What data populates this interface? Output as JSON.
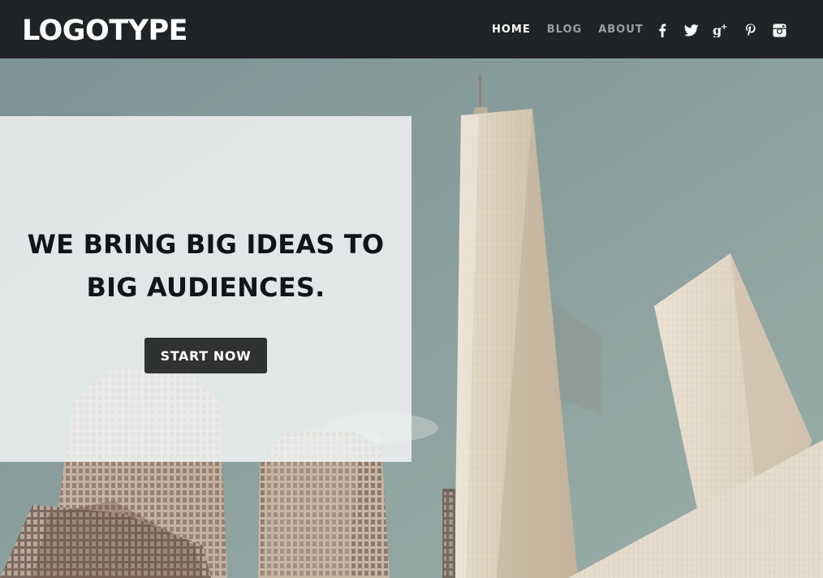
{
  "header": {
    "logo": "LOGOTYPE",
    "nav": [
      {
        "label": "HOME",
        "active": true
      },
      {
        "label": "BLOG",
        "active": false
      },
      {
        "label": "ABOUT",
        "active": false
      }
    ],
    "social": [
      "facebook-icon",
      "twitter-icon",
      "google-plus-icon",
      "pinterest-icon",
      "instagram-icon"
    ]
  },
  "hero": {
    "headline": "WE BRING BIG IDEAS TO BIG AUDIENCES.",
    "cta_label": "START NOW"
  },
  "colors": {
    "header_bg": "#212426",
    "nav_active": "#ffffff",
    "nav_inactive": "#9a9ea1",
    "panel_bg": "#f0f3f3",
    "button_bg": "#2f3133",
    "headline": "#121417"
  }
}
